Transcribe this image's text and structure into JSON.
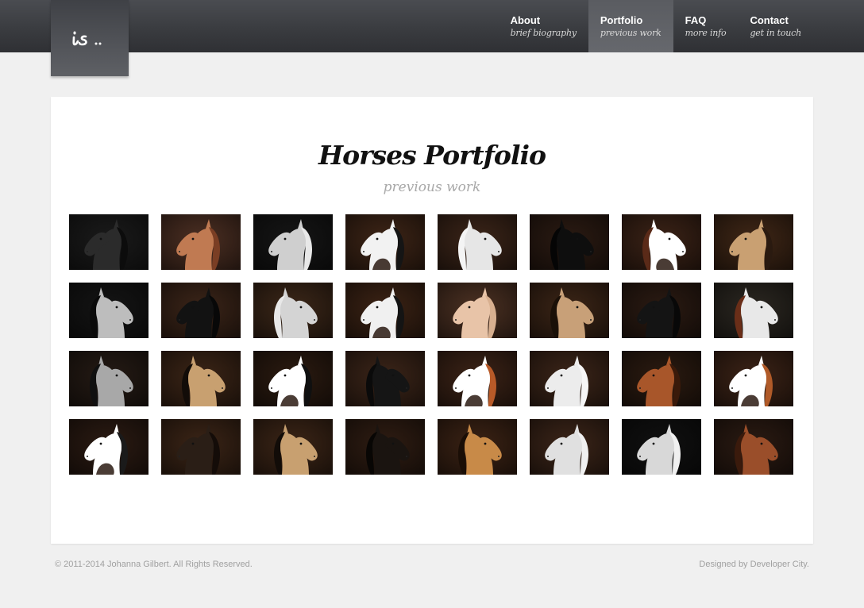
{
  "logo": {
    "text": "is..",
    "icon": "script-monogram-logo"
  },
  "nav": [
    {
      "title": "About",
      "subtitle": "brief biography",
      "active": false
    },
    {
      "title": "Portfolio",
      "subtitle": "previous work",
      "active": true
    },
    {
      "title": "FAQ",
      "subtitle": "more info",
      "active": false
    },
    {
      "title": "Contact",
      "subtitle": "get in touch",
      "active": false
    }
  ],
  "main": {
    "title": "Horses Portfolio",
    "subtitle": "previous work"
  },
  "gallery": [
    {
      "bg": "#1a1a1a",
      "coat": "#2b2b2b",
      "mane": "#0c0c0c",
      "facing": "left"
    },
    {
      "bg": "#4a2e22",
      "coat": "#c07a52",
      "mane": "#7a3e24",
      "facing": "left"
    },
    {
      "bg": "#151515",
      "coat": "#cfcfcf",
      "mane": "#e8e8e8",
      "facing": "left"
    },
    {
      "bg": "#3c2416",
      "coat": "#f2f2f2",
      "mane": "#151515",
      "facing": "left",
      "pinto": true
    },
    {
      "bg": "#3a2418",
      "coat": "#e6e6e6",
      "mane": "#f4f4f4",
      "facing": "right"
    },
    {
      "bg": "#2a1a12",
      "coat": "#0e0e0e",
      "mane": "#050505",
      "facing": "right"
    },
    {
      "bg": "#3a2216",
      "coat": "#ffffff",
      "mane": "#5a2a18",
      "facing": "right",
      "pinto": true
    },
    {
      "bg": "#3e2616",
      "coat": "#c9a072",
      "mane": "#2a1a10",
      "facing": "left"
    },
    {
      "bg": "#141414",
      "coat": "#bdbdbd",
      "mane": "#0a0a0a",
      "facing": "right"
    },
    {
      "bg": "#3a2418",
      "coat": "#121212",
      "mane": "#080808",
      "facing": "left"
    },
    {
      "bg": "#3a2618",
      "coat": "#d4d4d4",
      "mane": "#e8e8e8",
      "facing": "right"
    },
    {
      "bg": "#3a2214",
      "coat": "#f0f0f0",
      "mane": "#141414",
      "facing": "left",
      "pinto": true
    },
    {
      "bg": "#4a3022",
      "coat": "#e8c4a8",
      "mane": "#d8b090",
      "facing": "left"
    },
    {
      "bg": "#3a2416",
      "coat": "#c8a078",
      "mane": "#1a1008",
      "facing": "right"
    },
    {
      "bg": "#2a1a12",
      "coat": "#141414",
      "mane": "#080808",
      "facing": "left"
    },
    {
      "bg": "#2a2620",
      "coat": "#e8e8e8",
      "mane": "#6a2e18",
      "facing": "right"
    },
    {
      "bg": "#241a14",
      "coat": "#a8a8a8",
      "mane": "#101010",
      "facing": "right"
    },
    {
      "bg": "#3a2416",
      "coat": "#c8a070",
      "mane": "#120c08",
      "facing": "right"
    },
    {
      "bg": "#2a1a10",
      "coat": "#ffffff",
      "mane": "#101010",
      "facing": "left",
      "pinto": true
    },
    {
      "bg": "#3a2418",
      "coat": "#151515",
      "mane": "#0a0a0a",
      "facing": "right"
    },
    {
      "bg": "#3a2216",
      "coat": "#ffffff",
      "mane": "#b85a28",
      "facing": "left",
      "pinto": true
    },
    {
      "bg": "#3a2418",
      "coat": "#ececec",
      "mane": "#f6f6f6",
      "facing": "left"
    },
    {
      "bg": "#2a1a10",
      "coat": "#a8562a",
      "mane": "#3a1a0a",
      "facing": "left"
    },
    {
      "bg": "#3a2216",
      "coat": "#ffffff",
      "mane": "#b05a28",
      "facing": "left",
      "pinto": true
    },
    {
      "bg": "#2a1a12",
      "coat": "#ffffff",
      "mane": "#1a1a1a",
      "facing": "left",
      "pinto": true
    },
    {
      "bg": "#3a2416",
      "coat": "#2a1e16",
      "mane": "#140c08",
      "facing": "left"
    },
    {
      "bg": "#3a2416",
      "coat": "#c8a070",
      "mane": "#120c08",
      "facing": "right"
    },
    {
      "bg": "#2e1c12",
      "coat": "#1a1410",
      "mane": "#080604",
      "facing": "right"
    },
    {
      "bg": "#3a2214",
      "coat": "#c88a48",
      "mane": "#1a0e06",
      "facing": "right"
    },
    {
      "bg": "#3a2418",
      "coat": "#e0e0e0",
      "mane": "#f0f0f0",
      "facing": "left"
    },
    {
      "bg": "#101010",
      "coat": "#d8d8d8",
      "mane": "#f0f0f0",
      "facing": "left"
    },
    {
      "bg": "#2a1a12",
      "coat": "#9a4e2a",
      "mane": "#3a1a0c",
      "facing": "right"
    }
  ],
  "footer": {
    "copyright": "© 2011-2014 Johanna Gilbert. All Rights Reserved.",
    "credit": "Designed by Developer City."
  }
}
